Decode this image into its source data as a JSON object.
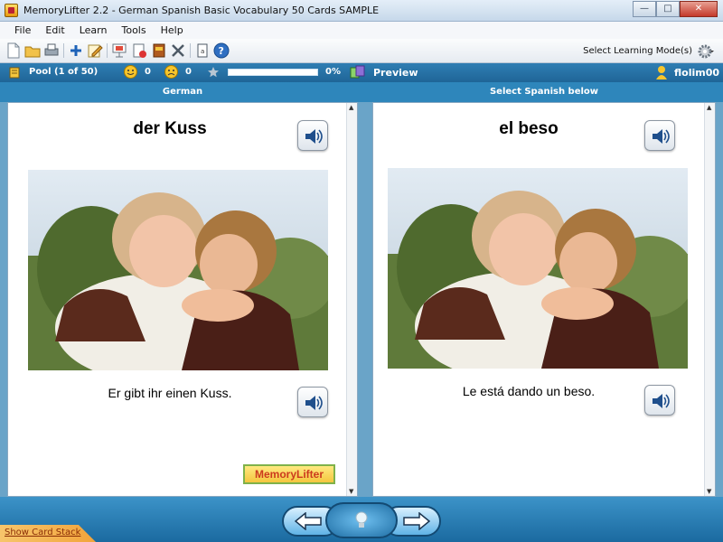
{
  "window": {
    "title": "MemoryLifter 2.2 - German Spanish Basic Vocabulary 50 Cards SAMPLE",
    "controls": [
      "minimize",
      "maximize",
      "close"
    ]
  },
  "menu": [
    "File",
    "Edit",
    "Learn",
    "Tools",
    "Help"
  ],
  "toolbar": {
    "icons": [
      "new-icon",
      "open-icon",
      "print-icon",
      "add-card-icon",
      "edit-icon",
      "presentation-icon",
      "card-stack-icon",
      "book-icon",
      "settings-tools-icon",
      "dictionary-icon",
      "help-icon"
    ],
    "mode_label": "Select Learning Mode(s)"
  },
  "status": {
    "pool_label": "Pool",
    "pool_count": "(1 of 50)",
    "happy_count": "0",
    "sad_count": "0",
    "progress_percent": 0,
    "progress_label": "0%",
    "preview_label": "Preview",
    "username": "flolim00"
  },
  "columns": {
    "left_header": "German",
    "right_header": "Select Spanish below"
  },
  "card": {
    "question_word": "der Kuss",
    "question_sentence": "Er gibt ihr einen Kuss.",
    "answer_word": "el beso",
    "answer_sentence": "Le está dando un beso.",
    "logo_text": "MemoryLifter"
  },
  "bottom": {
    "show_stack_label": "Show Card Stack"
  },
  "colors": {
    "accent_blue": "#2e86bb",
    "status_blue": "#1f6597",
    "logo_yellow": "#f4c63e"
  }
}
